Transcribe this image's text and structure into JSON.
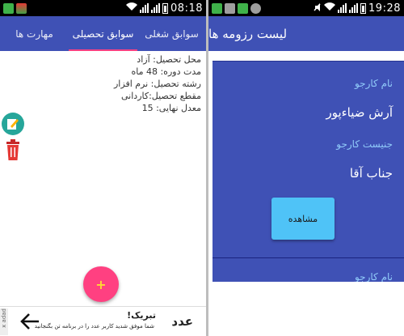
{
  "left_screen": {
    "status_bar": {
      "time": "08:18"
    },
    "tabs": [
      {
        "label": "سوابق شغلی"
      },
      {
        "label": "سوابق تحصیلی"
      },
      {
        "label": "مهارت ها"
      }
    ],
    "education": {
      "place": "محل تحصیل: آزاد",
      "duration": "مدت دوره: 48 ماه",
      "field": "رشته تحصیل: نرم افزار",
      "level": "مقطع تحصیل:کاردانی",
      "grade": "معدل نهایی: 15"
    },
    "fab": {
      "label": "+"
    },
    "ad": {
      "badge": "x adad",
      "title": "تبریک!",
      "subtitle": "شما موفق شدید کاربر عدد را در برنامه تن بگنجانید",
      "brand": "عدد"
    }
  },
  "right_screen": {
    "status_bar": {
      "time": "19:28"
    },
    "toolbar": {
      "title": "لیست رزومه ها"
    },
    "resumes": [
      {
        "name_label": "نام کارجو",
        "name_value": "آرش ضیاءپور",
        "gender_label": "جنیست کارجو",
        "gender_value": "جناب آقا",
        "view_button": "مشاهده"
      },
      {
        "name_label": "نام کارجو"
      }
    ]
  },
  "colors": {
    "primary": "#3f51b5",
    "accent": "#ff4081",
    "button": "#4fc3f7"
  }
}
